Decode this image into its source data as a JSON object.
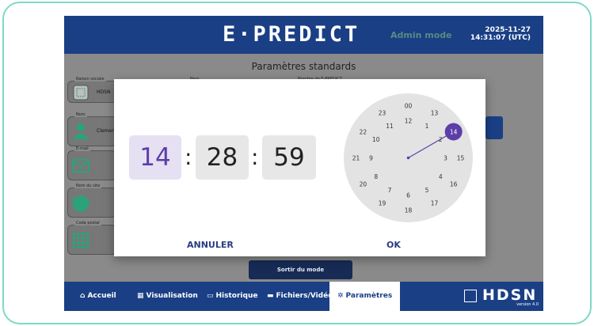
{
  "header": {
    "logo": "E·PREDICT",
    "mode": "Admin mode",
    "date": "2025-11-27",
    "time": "14:31:07 (UTC)"
  },
  "background": {
    "title": "Paramètres standards",
    "fields": [
      {
        "label": "Raison sociale",
        "value": "HDSN"
      },
      {
        "label": "Pays",
        "value": ""
      },
      {
        "label": "Nombre de E-PREDICT",
        "value": ""
      },
      {
        "label": "Nom",
        "value": "Clement"
      },
      {
        "label": "E-mail",
        "value": ""
      },
      {
        "label": "Nom du site",
        "value": ""
      },
      {
        "label": "Code postal",
        "value": ""
      }
    ],
    "exit_label": "Sortir du mode"
  },
  "picker": {
    "hours": "14",
    "minutes": "28",
    "seconds": "59",
    "sep1": ":",
    "sep2": ":",
    "cancel": "ANNULER",
    "ok": "OK",
    "selected_hour": 14,
    "outer_numbers": [
      "00",
      "13",
      "14",
      "15",
      "16",
      "17",
      "18",
      "19",
      "20",
      "21",
      "22",
      "23"
    ],
    "inner_numbers": [
      "12",
      "1",
      "2",
      "3",
      "4",
      "5",
      "6",
      "7",
      "8",
      "9",
      "10",
      "11"
    ]
  },
  "nav": {
    "items": [
      {
        "label": "Accueil",
        "icon": "home-icon"
      },
      {
        "label": "Visualisation",
        "icon": "grid-icon"
      },
      {
        "label": "Historique",
        "icon": "calendar-icon"
      },
      {
        "label": "Fichiers/Vidéo",
        "icon": "folder-icon"
      },
      {
        "label": "Paramètres",
        "icon": "gear-icon"
      }
    ],
    "brand": "HDSN",
    "version": "version 4.0"
  },
  "colors": {
    "primary": "#1a3f85",
    "accent": "#5c3ea8",
    "frame": "#7fd9c4",
    "icon_green": "#2aa37a"
  }
}
